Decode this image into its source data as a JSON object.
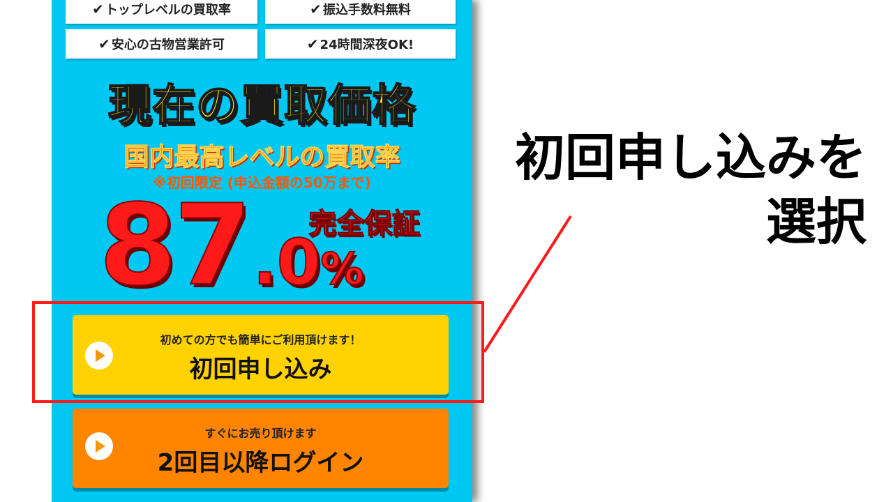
{
  "features": [
    {
      "check": "✔",
      "label": "トップレベルの買取率"
    },
    {
      "check": "✔",
      "label": "振込手数料無料"
    },
    {
      "check": "✔",
      "label": "安心の古物営業許可"
    },
    {
      "check": "✔",
      "label": "24時間深夜OK!"
    }
  ],
  "price_title": "現在の買取価格",
  "rate_subtitle": "国内最高レベルの買取率",
  "note": "※初回限定 (申込金額の50万まで)",
  "guarantee": "完全保証",
  "rate": {
    "integer": "87",
    "decimal": ".0",
    "unit": "%"
  },
  "buttons": {
    "first": {
      "sub": "初めての方でも簡単にご利用頂けます！",
      "main": "初回申し込み"
    },
    "login": {
      "sub": "すぐにお売り頂けます",
      "main": "2回目以降ログイン"
    }
  },
  "callout": {
    "line1": "初回申し込みを",
    "line2": "選択"
  },
  "colors": {
    "panel_bg": "#00c8f2",
    "first_button": "#ffd200",
    "login_button": "#ff8400",
    "highlight": "#ff1a1a",
    "rate_red": "#ff1a1a",
    "title_yellow": "#ffe600"
  },
  "icons": {
    "button_icon": "play-icon"
  }
}
